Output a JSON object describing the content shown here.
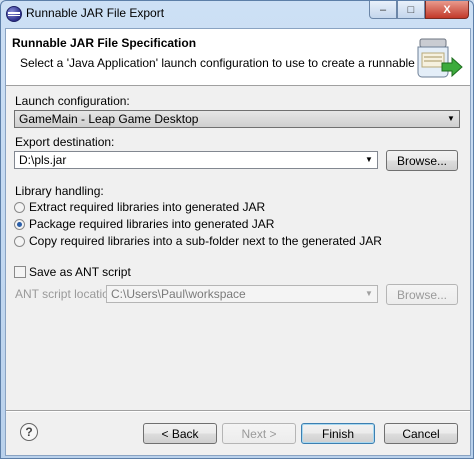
{
  "window": {
    "title": "Runnable JAR File Export",
    "minimize": "–",
    "maximize": "□",
    "close": "X"
  },
  "header": {
    "title": "Runnable JAR File Specification",
    "description": "Select a 'Java Application' launch configuration to use to create a runnable JAR."
  },
  "launch": {
    "label": "Launch configuration:",
    "value": "GameMain - Leap Game Desktop"
  },
  "export": {
    "label": "Export destination:",
    "value": "D:\\pls.jar",
    "browse": "Browse..."
  },
  "library": {
    "label": "Library handling:",
    "options": [
      {
        "label": "Extract required libraries into generated JAR",
        "selected": false
      },
      {
        "label": "Package required libraries into generated JAR",
        "selected": true
      },
      {
        "label": "Copy required libraries into a sub-folder next to the generated JAR",
        "selected": false
      }
    ]
  },
  "ant": {
    "checkbox_label": "Save as ANT script",
    "checked": false,
    "location_label": "ANT script location:",
    "location_value": "C:\\Users\\Paul\\workspace",
    "browse": "Browse..."
  },
  "footer": {
    "help": "?",
    "back": "< Back",
    "next": "Next >",
    "finish": "Finish",
    "cancel": "Cancel"
  },
  "icons": {
    "app": "eclipse-icon",
    "banner": "jar-export-icon",
    "help": "help-icon"
  }
}
